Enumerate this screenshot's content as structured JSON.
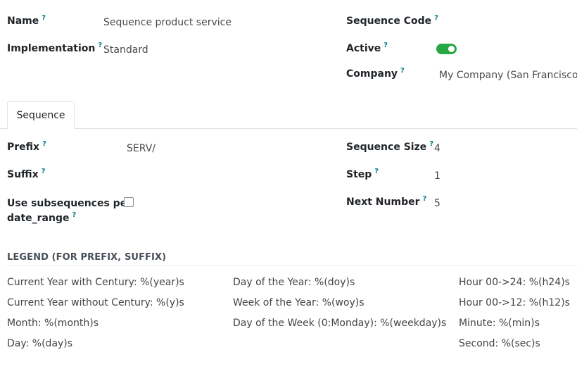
{
  "header": {
    "name_label": "Name",
    "name_value": "Sequence product service",
    "implementation_label": "Implementation",
    "implementation_value": "Standard",
    "sequence_code_label": "Sequence Code",
    "sequence_code_value": "",
    "active_label": "Active",
    "active_value": true,
    "company_label": "Company",
    "company_value": "My Company (San Francisco)"
  },
  "tooltip_mark": "?",
  "tabs": [
    {
      "label": "Sequence",
      "active": true
    }
  ],
  "sequence": {
    "prefix_label": "Prefix",
    "prefix_value": "SERV/",
    "suffix_label": "Suffix",
    "suffix_value": "",
    "subseq_label_line1": "Use subsequences per",
    "subseq_label_line2": "date_range",
    "subseq_checked": false,
    "size_label": "Sequence Size",
    "size_value": "4",
    "step_label": "Step",
    "step_value": "1",
    "next_label": "Next Number",
    "next_value": "5"
  },
  "legend": {
    "title": "LEGEND (FOR PREFIX, SUFFIX)",
    "col1": [
      "Current Year with Century: %(year)s",
      "Current Year without Century: %(y)s",
      "Month: %(month)s",
      "Day: %(day)s"
    ],
    "col2": [
      "Day of the Year: %(doy)s",
      "Week of the Year: %(woy)s",
      "Day of the Week (0:Monday): %(weekday)s"
    ],
    "col3": [
      "Hour 00->24: %(h24)s",
      "Hour 00->12: %(h12)s",
      "Minute: %(min)s",
      "Second: %(sec)s"
    ]
  },
  "colors": {
    "toggle_on": "#28a745",
    "tooltip": "#017e84"
  }
}
